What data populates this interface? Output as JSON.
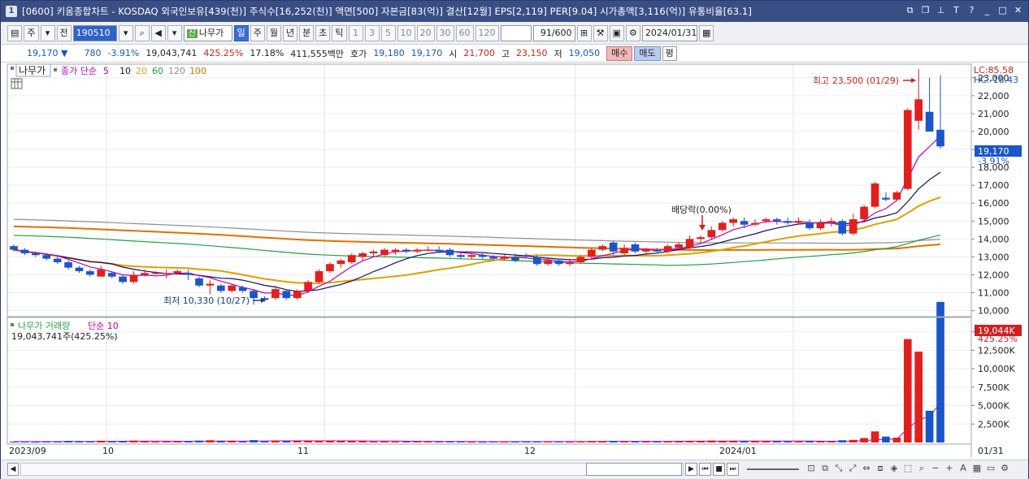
{
  "title_bar": {
    "icon_label": "1",
    "text": "[0600] 키움종합차트 - KOSDAQ 외국인보유[439(천)] 주식수[16,252(천)] 액면[500] 자본금[83(억)] 결산[12월] EPS[2,119] PER[9.04] 시가총액[3,116(억)] 유통비율[63.1]",
    "buttons": [
      "link-icon",
      "restore-icon",
      "pin-icon",
      "text-icon",
      "help-icon",
      "minimize-icon",
      "maximize-icon",
      "close-icon"
    ]
  },
  "toolbar": {
    "type_select": "주",
    "all_label": "전",
    "code": "190510",
    "search_icon": "search-icon",
    "sound_icon": "speaker-icon",
    "new_badge": "신",
    "stock_name": "나무가",
    "periods": [
      "일",
      "주",
      "월",
      "년",
      "분",
      "초",
      "틱"
    ],
    "selected_period": "일",
    "intervals": [
      "1",
      "3",
      "5",
      "10",
      "20",
      "30",
      "60",
      "120"
    ],
    "count_value": "91",
    "count_max": "/600",
    "date": "2024/01/31"
  },
  "quote_bar": {
    "price": "19,170",
    "arrow": "▼",
    "change": "780",
    "change_pct": "-3.91%",
    "volume": "19,043,741",
    "volume_ratio": "425.25%",
    "turnover": "17.18%",
    "amount": "411,555백만",
    "ask_label": "호가",
    "ask": "19,180",
    "bid": "19,170",
    "open_label": "시",
    "open": "21,700",
    "high_label": "고",
    "high": "23,150",
    "low_label": "저",
    "low": "19,050",
    "buy_label": "매수",
    "sell_label": "매도",
    "flat_label": "평"
  },
  "price_panel": {
    "stock_tag": "나무가",
    "indicator_label": "종가 단순",
    "ma_periods": [
      "5",
      "10",
      "20",
      "60",
      "120",
      "100"
    ],
    "ma_colors": [
      "#c000c0",
      "#101060",
      "#e0a000",
      "#20a040",
      "#909090",
      "#e07000"
    ],
    "lc_label": "LC:85.58",
    "hc_label": "HC:-18.43",
    "current_price": "19,170",
    "current_pct": "-3.91%",
    "high_annotation": "최고 23,500 (01/29)",
    "low_annotation": "최저 10,330 (10/27)",
    "dividend_annotation": "배당락(0.00%)",
    "y_ticks": [
      "23,000",
      "22,000",
      "21,000",
      "20,000",
      "19,000",
      "18,000",
      "17,000",
      "16,000",
      "15,000",
      "14,000",
      "13,000",
      "12,000",
      "11,000",
      "10,000"
    ]
  },
  "volume_panel": {
    "label": "나무가 거래량",
    "indicator": "단순 10",
    "summary": "19,043,741주(425.25%)",
    "current": "19,044K",
    "current_pct": "425.25%",
    "y_ticks": [
      "15,000K",
      "12,500K",
      "10,000K",
      "7,500K",
      "5,000K",
      "2,500K"
    ]
  },
  "x_axis": {
    "labels": [
      "2023/09",
      "10",
      "11",
      "12",
      "2024/01"
    ],
    "last_date": "01/31"
  },
  "chart_data": {
    "type": "candlestick",
    "price_range": [
      9800,
      23400
    ],
    "volume_range": [
      0,
      16500
    ],
    "volume_unit": "K",
    "candles": [
      [
        13600,
        13700,
        13300,
        13400
      ],
      [
        13400,
        13500,
        13100,
        13200
      ],
      [
        13200,
        13300,
        13000,
        13100
      ],
      [
        13100,
        13200,
        12800,
        12900
      ],
      [
        12900,
        13000,
        12600,
        12700
      ],
      [
        12700,
        12800,
        12300,
        12400
      ],
      [
        12400,
        12500,
        12100,
        12200
      ],
      [
        12200,
        12300,
        11900,
        12000
      ],
      [
        11900,
        12500,
        11900,
        12300
      ],
      [
        12100,
        12200,
        11800,
        11900
      ],
      [
        11900,
        12000,
        11500,
        11600
      ],
      [
        11600,
        12200,
        11500,
        12000
      ],
      [
        12000,
        12300,
        11900,
        12100
      ],
      [
        12100,
        12200,
        12000,
        12100
      ],
      [
        12100,
        12300,
        11800,
        12100
      ],
      [
        12100,
        12300,
        12000,
        12200
      ],
      [
        12100,
        12300,
        11700,
        12000
      ],
      [
        11800,
        11900,
        11300,
        11400
      ],
      [
        11400,
        11700,
        10900,
        11500
      ],
      [
        11400,
        11500,
        11000,
        11100
      ],
      [
        11100,
        11500,
        11000,
        11400
      ],
      [
        11300,
        11400,
        11000,
        11100
      ],
      [
        11100,
        11200,
        10330,
        10700
      ],
      [
        10700,
        10800,
        10500,
        10600
      ],
      [
        10700,
        11400,
        10600,
        11200
      ],
      [
        11100,
        11200,
        10600,
        10700
      ],
      [
        10700,
        11200,
        10600,
        11100
      ],
      [
        11100,
        11700,
        11000,
        11600
      ],
      [
        11600,
        12300,
        11500,
        12200
      ],
      [
        12200,
        12700,
        12100,
        12600
      ],
      [
        12600,
        12900,
        12400,
        12800
      ],
      [
        12700,
        13200,
        12600,
        13100
      ],
      [
        13000,
        13300,
        12800,
        13200
      ],
      [
        13200,
        13400,
        13000,
        13300
      ],
      [
        13100,
        13500,
        13000,
        13400
      ],
      [
        13300,
        13500,
        13100,
        13400
      ],
      [
        13400,
        13500,
        13200,
        13300
      ],
      [
        13300,
        13500,
        13200,
        13400
      ],
      [
        13400,
        13600,
        13300,
        13400
      ],
      [
        13400,
        13600,
        13200,
        13300
      ],
      [
        13400,
        13500,
        13000,
        13100
      ],
      [
        13100,
        13200,
        12900,
        13000
      ],
      [
        13000,
        13200,
        12900,
        13100
      ],
      [
        13100,
        13200,
        12900,
        13000
      ],
      [
        13000,
        13100,
        12800,
        12900
      ],
      [
        12900,
        13100,
        12800,
        13000
      ],
      [
        13000,
        13200,
        12700,
        12800
      ],
      [
        13100,
        13200,
        12900,
        13000
      ],
      [
        13000,
        13100,
        12500,
        12600
      ],
      [
        12600,
        12900,
        12500,
        12800
      ],
      [
        12800,
        12900,
        12500,
        12600
      ],
      [
        12600,
        12900,
        12500,
        12700
      ],
      [
        12700,
        13100,
        12600,
        13000
      ],
      [
        13000,
        13500,
        12900,
        13400
      ],
      [
        13400,
        13700,
        13300,
        13600
      ],
      [
        13800,
        13900,
        13100,
        13300
      ],
      [
        13200,
        13700,
        13100,
        13500
      ],
      [
        13700,
        13800,
        13200,
        13300
      ],
      [
        13300,
        13500,
        13100,
        13400
      ],
      [
        13400,
        13500,
        13200,
        13300
      ],
      [
        13300,
        13700,
        13200,
        13600
      ],
      [
        13500,
        13800,
        13400,
        13700
      ],
      [
        13500,
        14200,
        13400,
        14000
      ],
      [
        14000,
        14200,
        13800,
        14100
      ],
      [
        14100,
        14700,
        14000,
        14500
      ],
      [
        14500,
        15000,
        14400,
        14900
      ],
      [
        14900,
        15200,
        14700,
        15100
      ],
      [
        15000,
        15200,
        14600,
        14800
      ],
      [
        14800,
        15100,
        14700,
        14900
      ],
      [
        15000,
        15200,
        14900,
        15100
      ],
      [
        15100,
        15200,
        14800,
        15000
      ],
      [
        15000,
        15200,
        14800,
        14900
      ],
      [
        14900,
        15200,
        14800,
        15000
      ],
      [
        14900,
        15100,
        14500,
        14600
      ],
      [
        14600,
        15100,
        14500,
        14900
      ],
      [
        14900,
        15200,
        14700,
        15000
      ],
      [
        15000,
        15100,
        14200,
        14300
      ],
      [
        14300,
        15400,
        14200,
        15100
      ],
      [
        15100,
        15900,
        15000,
        15800
      ],
      [
        15800,
        17200,
        15700,
        17100
      ],
      [
        16300,
        16600,
        16100,
        16200
      ],
      [
        16200,
        16700,
        16100,
        16600
      ],
      [
        16800,
        21300,
        16700,
        21200
      ],
      [
        20600,
        23500,
        20100,
        21800
      ],
      [
        21100,
        23000,
        20100,
        20000
      ],
      [
        20100,
        23150,
        19050,
        19170
      ]
    ],
    "volumes": [
      120,
      110,
      100,
      140,
      160,
      220,
      180,
      150,
      230,
      140,
      200,
      250,
      140,
      90,
      110,
      130,
      180,
      250,
      300,
      180,
      200,
      150,
      320,
      180,
      260,
      170,
      200,
      230,
      260,
      240,
      180,
      200,
      160,
      130,
      150,
      120,
      110,
      120,
      130,
      110,
      140,
      120,
      100,
      90,
      110,
      100,
      140,
      130,
      160,
      120,
      110,
      100,
      130,
      180,
      200,
      220,
      150,
      170,
      130,
      120,
      150,
      180,
      220,
      200,
      260,
      230,
      200,
      190,
      150,
      170,
      160,
      150,
      140,
      180,
      170,
      150,
      300,
      350,
      600,
      1500,
      800,
      650,
      14000,
      12300,
      4300,
      19044
    ]
  }
}
